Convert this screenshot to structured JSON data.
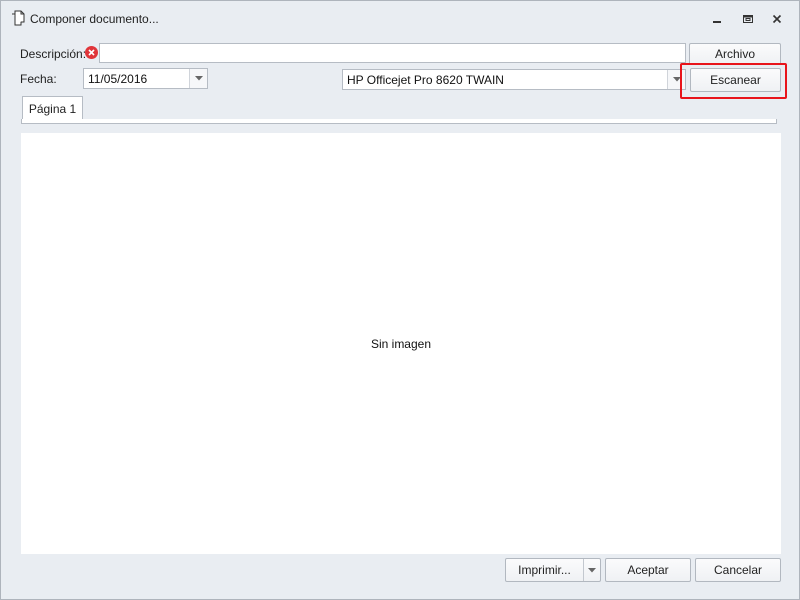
{
  "window": {
    "title": "Componer documento...",
    "icons": {
      "title": "document-copy-icon",
      "minimize": "minimize-icon",
      "maximize": "restore-icon",
      "close": "close-icon"
    }
  },
  "form": {
    "description_label": "Descripción:",
    "description_value": "",
    "error_icon": "error-icon",
    "date_label": "Fecha:",
    "date_value": "11/05/2016",
    "scanner_value": "HP Officejet Pro 8620 TWAIN",
    "archivo_button": "Archivo",
    "escanear_button": "Escanear"
  },
  "tabs": [
    {
      "label": "Página 1",
      "active": true
    }
  ],
  "preview": {
    "empty_text": "Sin imagen"
  },
  "footer": {
    "print_button": "Imprimir...",
    "accept_button": "Aceptar",
    "cancel_button": "Cancelar"
  },
  "colors": {
    "window_bg": "#e9edf2",
    "highlight": "#e8141b",
    "error": "#e0353a"
  }
}
